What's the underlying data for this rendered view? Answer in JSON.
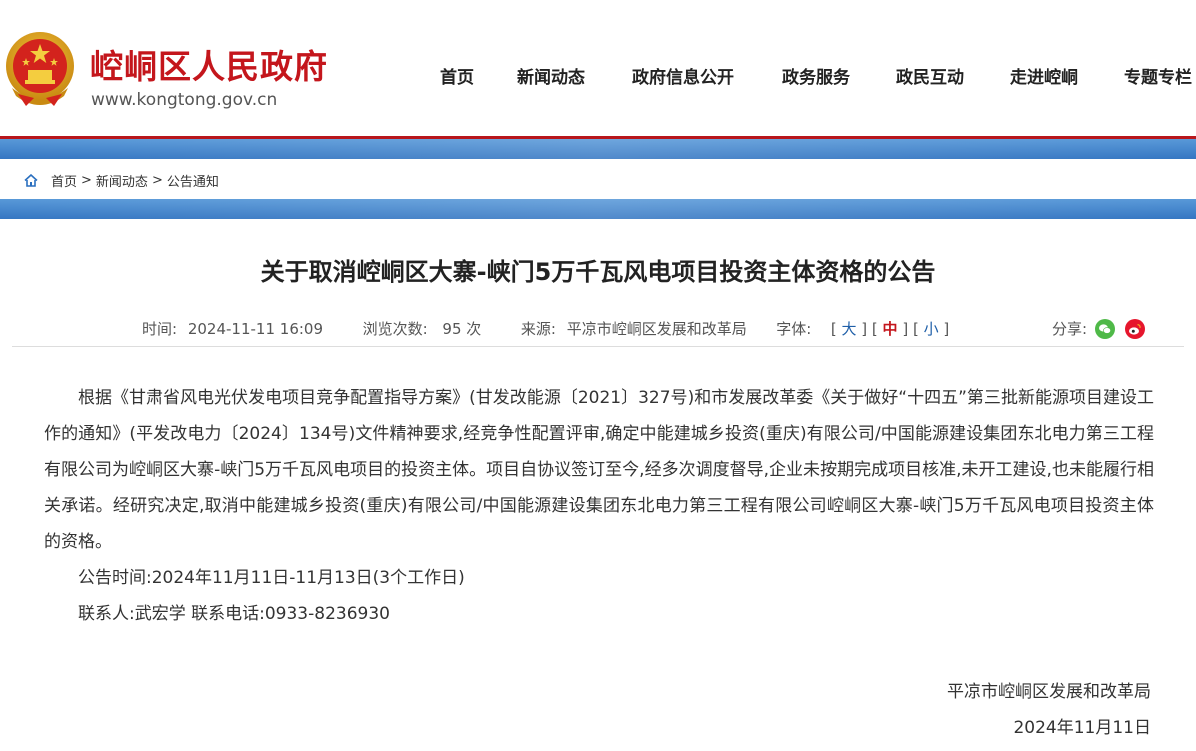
{
  "site": {
    "name": "崆峒区人民政府",
    "url": "www.kongtong.gov.cn"
  },
  "nav": {
    "items": [
      "首页",
      "新闻动态",
      "政府信息公开",
      "政务服务",
      "政民互动",
      "走进崆峒",
      "专题专栏"
    ]
  },
  "breadcrumb": {
    "items": [
      "首页",
      "新闻动态",
      "公告通知"
    ],
    "separator": ">"
  },
  "article": {
    "title": "关于取消崆峒区大寨-峡门5万千瓦风电项目投资主体资格的公告",
    "meta": {
      "time_label": "时间:",
      "time_value": "2024-11-11 16:09",
      "views_label": "浏览次数:",
      "views_value": "95 次",
      "source_label": "来源:",
      "source_value": "平凉市崆峒区发展和改革局",
      "font_label": "字体:",
      "font_large": "大",
      "font_medium": "中",
      "font_small": "小"
    },
    "share_label": "分享:",
    "paragraphs": [
      "根据《甘肃省风电光伏发电项目竞争配置指导方案》(甘发改能源〔2021〕327号)和市发展改革委《关于做好“十四五”第三批新能源项目建设工作的通知》(平发改电力〔2024〕134号)文件精神要求,经竞争性配置评审,确定中能建城乡投资(重庆)有限公司/中国能源建设集团东北电力第三工程有限公司为崆峒区大寨-峡门5万千瓦风电项目的投资主体。项目自协议签订至今,经多次调度督导,企业未按期完成项目核准,未开工建设,也未能履行相关承诺。经研究决定,取消中能建城乡投资(重庆)有限公司/中国能源建设集团东北电力第三工程有限公司崆峒区大寨-峡门5万千瓦风电项目投资主体的资格。",
      "公告时间:2024年11月11日-11月13日(3个工作日)",
      "联系人:武宏学 联系电话:0933-8236930"
    ],
    "signoff_org": "平凉市崆峒区发展和改革局",
    "signoff_date": "2024年11月11日"
  },
  "colors": {
    "brand_red": "#c4161c",
    "band_blue": "#2a6fbf",
    "link_blue": "#1f5fa8",
    "wechat_green": "#4fb948",
    "weibo_red": "#e6162d"
  },
  "icons": {
    "emblem": "national-emblem-icon",
    "home": "home-icon",
    "wechat": "wechat-icon",
    "weibo": "weibo-icon"
  }
}
